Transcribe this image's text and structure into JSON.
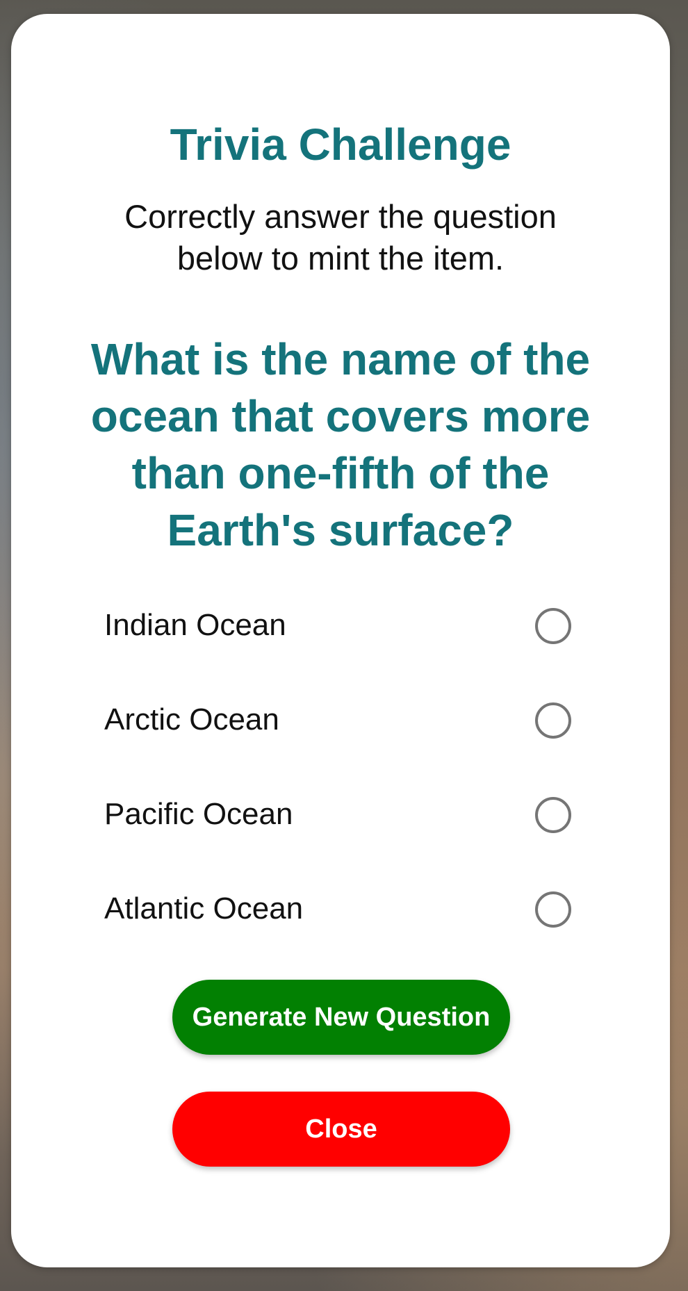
{
  "modal": {
    "title": "Trivia Challenge",
    "subtitle": "Correctly answer the question below to mint the item.",
    "question": "What is the name of the ocean that covers more than one-fifth of the Earth's surface?",
    "options": [
      {
        "label": "Indian Ocean",
        "selected": false
      },
      {
        "label": "Arctic Ocean",
        "selected": false
      },
      {
        "label": "Pacific Ocean",
        "selected": false
      },
      {
        "label": "Atlantic Ocean",
        "selected": false
      }
    ],
    "generate_button_label": "Generate New Question",
    "close_button_label": "Close"
  },
  "colors": {
    "accent": "#14737b",
    "generate_button": "#028002",
    "close_button": "#ff0000",
    "radio_border": "#757575"
  }
}
